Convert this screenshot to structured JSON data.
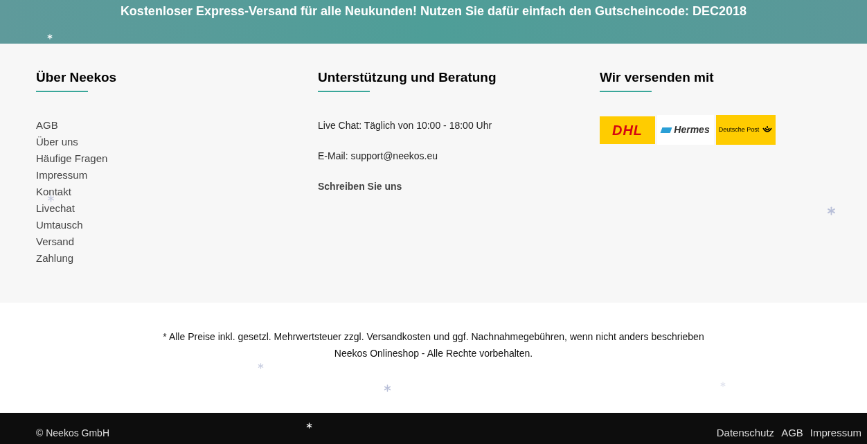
{
  "banner": {
    "text": "Kostenloser Express-Versand für alle Neukunden! Nutzen Sie dafür einfach den Gutscheincode: DEC2018"
  },
  "about": {
    "title": "Über Neekos",
    "links": [
      "AGB",
      "Über uns",
      "Häufige Fragen",
      "Impressum",
      "Kontakt",
      "Livechat",
      "Umtausch",
      "Versand",
      "Zahlung"
    ]
  },
  "support": {
    "title": "Unterstützung und Beratung",
    "lines": [
      "Live Chat: Täglich von 10:00 - 18:00 Uhr",
      "E-Mail: support@neekos.eu"
    ],
    "link": "Schreiben Sie uns"
  },
  "shipping": {
    "title": "Wir versenden mit",
    "carriers": [
      {
        "kind": "dhl",
        "name": "DHL"
      },
      {
        "kind": "hermes",
        "name": "Hermes"
      },
      {
        "kind": "post",
        "name": "Deutsche Post"
      }
    ]
  },
  "notice": [
    "* Alle Preise inkl. gesetzl. Mehrwertsteuer zzgl. Versandkosten und ggf. Nachnahmegebühren, wenn nicht anders beschrieben",
    "Neekos Onlineshop - Alle Rechte vorbehalten."
  ],
  "bottom_bar": {
    "copyright": "© Neekos GmbH",
    "links": [
      "Datenschutz",
      "AGB",
      "Impressum"
    ]
  }
}
